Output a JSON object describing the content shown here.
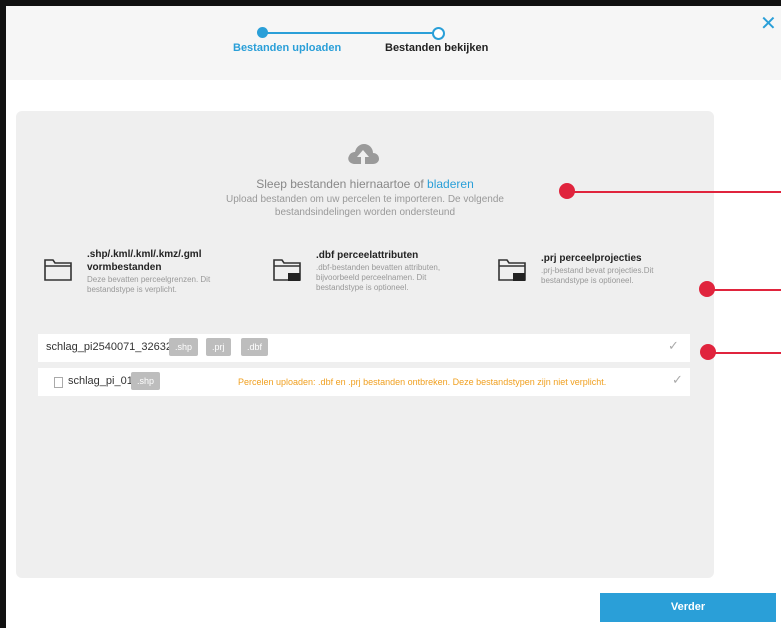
{
  "wizard": {
    "steps": [
      {
        "label": "Bestanden uploaden",
        "state": "active"
      },
      {
        "label": "Bestanden bekijken",
        "state": "next"
      }
    ]
  },
  "dropzone": {
    "text": "Sleep bestanden hiernaartoe of",
    "link": "bladeren",
    "subtext": "Upload bestanden om uw percelen te importeren. De volgende bestandsindelingen worden ondersteund"
  },
  "file_types": [
    {
      "ext": "",
      "title": ".shp/.kml/.kml/.kmz/.gml",
      "subtitle": "vormbestanden",
      "desc": "Deze bevatten perceelgrenzen. Dit bestandstype is verplicht."
    },
    {
      "ext": ".dbf",
      "title": ".dbf perceelattributen",
      "desc": ".dbf-bestanden bevatten attributen, bijvoorbeeld perceelnamen. Dit bestandstype is optioneel."
    },
    {
      "ext": ".prj",
      "title": ".prj perceelprojecties",
      "desc": ".prj-bestand bevat projecties.Dit bestandstype is optioneel."
    }
  ],
  "files": [
    {
      "name": "schlag_pi2540071_32632",
      "badges": [
        ".shp",
        ".prj",
        ".dbf"
      ],
      "status": "✓"
    },
    {
      "name": "schlag_pi_01",
      "badges": [
        ".shp"
      ],
      "warning": "Percelen uploaden: .dbf en .prj bestanden ontbreken. Deze bestandstypen zijn niet verplicht.",
      "status": "✓"
    }
  ],
  "footer": {
    "next_label": "Verder"
  },
  "close_symbol": "✕",
  "colors": {
    "accent": "#2a9fd8",
    "warning": "#f0a020",
    "annotation": "#e0243d",
    "badge": "#bdbdbd"
  }
}
